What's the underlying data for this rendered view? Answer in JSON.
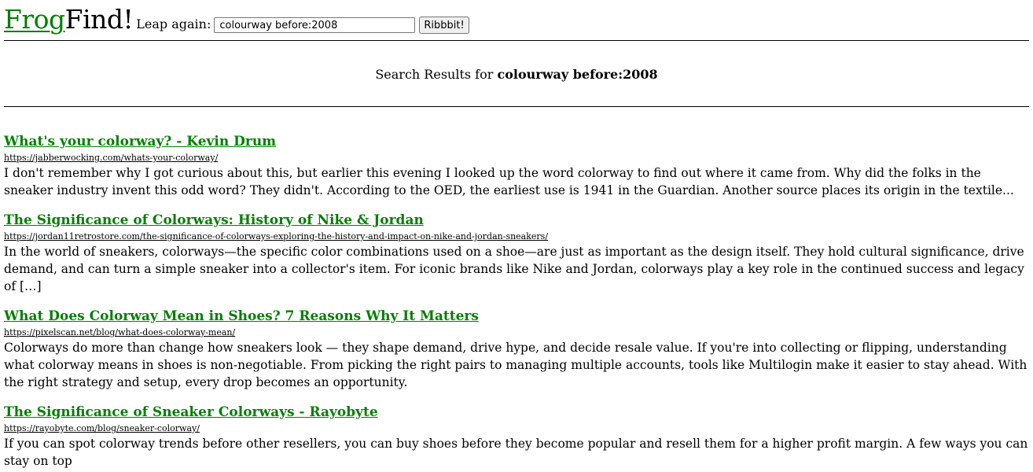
{
  "header": {
    "logo_frog": "Frog",
    "logo_find": "Find!",
    "leap_label": "Leap again:",
    "search_value": "colourway before:2008",
    "button_label": "Ribbbit!"
  },
  "results_heading": {
    "prefix": "Search Results for ",
    "query": "colourway before:2008"
  },
  "results": [
    {
      "title": "What's your colorway? - Kevin Drum",
      "url": "https://jabberwocking.com/whats-your-colorway/",
      "snippet": "I don't remember why I got curious about this, but earlier this evening I looked up the word colorway to find out where it came from. Why did the folks in the sneaker industry invent this odd word? They didn't. According to the OED, the earliest use is 1941 in the Guardian. Another source places its origin in the textile..."
    },
    {
      "title": "The Significance of Colorways: History of Nike & Jordan",
      "url": "https://jordan11retrostore.com/the-significance-of-colorways-exploring-the-history-and-impact-on-nike-and-jordan-sneakers/",
      "snippet": "In the world of sneakers, colorways—the specific color combinations used on a shoe—are just as important as the design itself. They hold cultural significance, drive demand, and can turn a simple sneaker into a collector's item. For iconic brands like Nike and Jordan, colorways play a key role in the continued success and legacy of […]"
    },
    {
      "title": "What Does Colorway Mean in Shoes? 7 Reasons Why It Matters",
      "url": "https://pixelscan.net/blog/what-does-colorway-mean/",
      "snippet": "Colorways do more than change how sneakers look — they shape demand, drive hype, and decide resale value. If you're into collecting or flipping, understanding what colorway means in shoes is non-negotiable. From picking the right pairs to managing multiple accounts, tools like Multilogin make it easier to stay ahead. With the right strategy and setup, every drop becomes an opportunity."
    },
    {
      "title": "The Significance of Sneaker Colorways - Rayobyte",
      "url": "https://rayobyte.com/blog/sneaker-colorway/",
      "snippet": "If you can spot colorway trends before other resellers, you can buy shoes before they become popular and resell them for a higher profit margin. A few ways you can stay on top"
    }
  ]
}
